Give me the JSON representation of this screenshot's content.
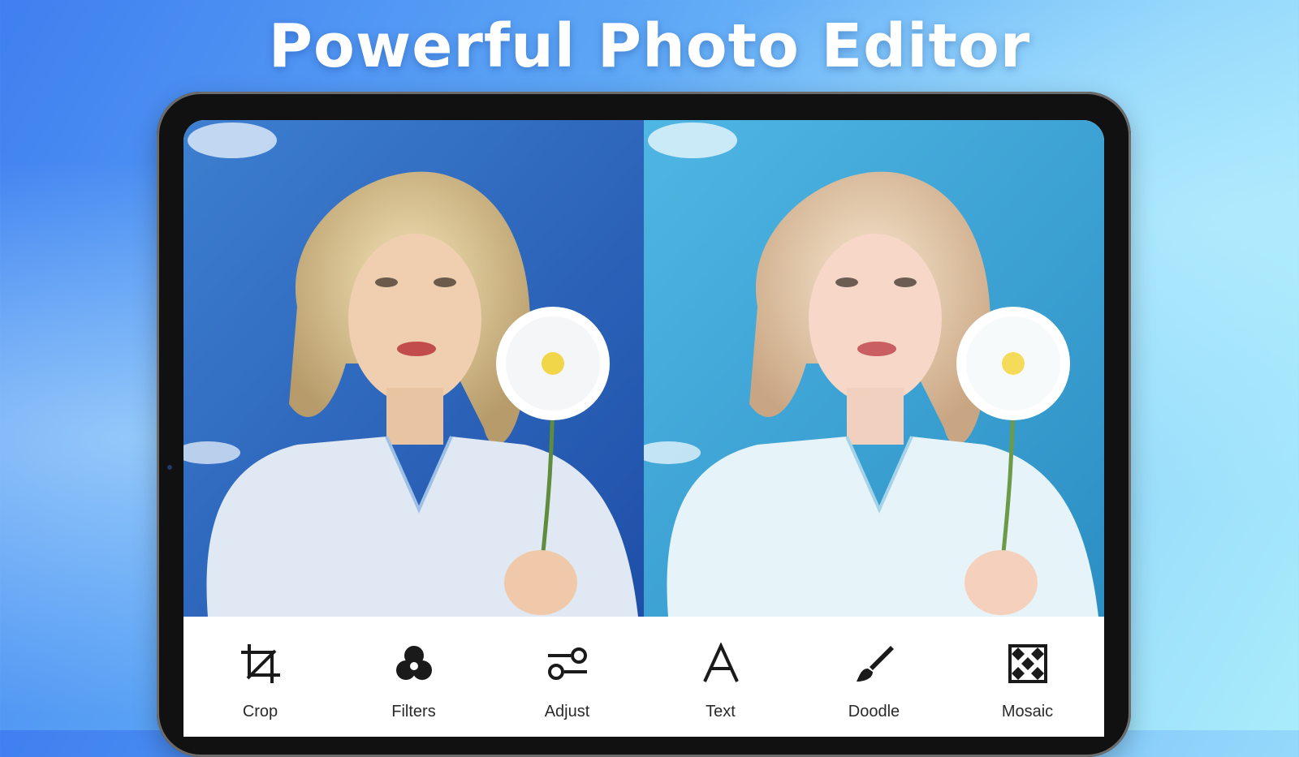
{
  "headline": "Powerful Photo Editor",
  "photos": {
    "before": {
      "label": "original-photo"
    },
    "after": {
      "label": "edited-photo"
    }
  },
  "toolbar": {
    "items": [
      {
        "label": "Crop",
        "icon": "crop-icon"
      },
      {
        "label": "Filters",
        "icon": "filters-icon"
      },
      {
        "label": "Adjust",
        "icon": "adjust-icon"
      },
      {
        "label": "Text",
        "icon": "text-icon"
      },
      {
        "label": "Doodle",
        "icon": "brush-icon"
      },
      {
        "label": "Mosaic",
        "icon": "mosaic-icon"
      }
    ]
  },
  "colors": {
    "background_start": "#3f7ff0",
    "background_end": "#a9ecfb",
    "device_frame": "#111111",
    "toolbar_bg": "#ffffff",
    "icon_color": "#1a1a1a"
  }
}
